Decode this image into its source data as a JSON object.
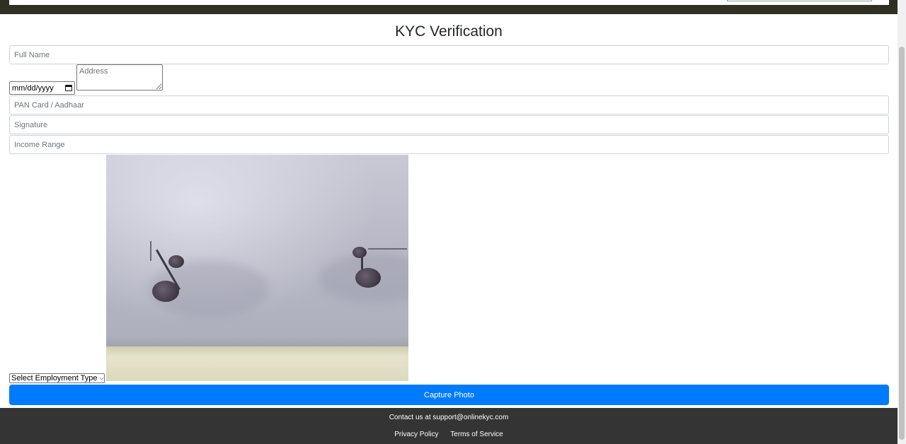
{
  "page": {
    "title": "KYC Verification"
  },
  "form": {
    "full_name_placeholder": "Full Name",
    "date_placeholder": "mm/dd/yyyy",
    "address_placeholder": "Address",
    "pan_placeholder": "PAN Card / Aadhaar",
    "signature_placeholder": "Signature",
    "income_placeholder": "Income Range",
    "employment_select_value": "Select Employment Type",
    "capture_label": "Capture Photo"
  },
  "footer": {
    "contact": "Contact us at support@onlinekyc.com",
    "privacy_label": "Privacy Policy",
    "terms_label": "Terms of Service"
  },
  "colors": {
    "primary_button": "#007bff",
    "footer_bg": "#343434",
    "top_bar_bg": "#2f2f22"
  },
  "icons": {
    "date_picker": "calendar-icon",
    "select_arrow": "chevron-down-icon"
  }
}
